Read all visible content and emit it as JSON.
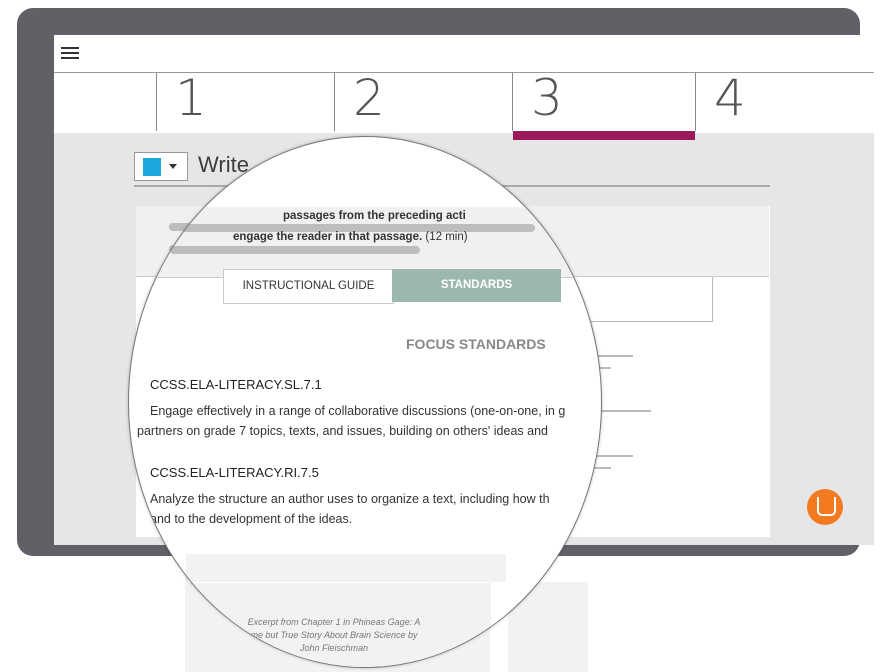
{
  "steps": [
    {
      "label": "1",
      "active": false
    },
    {
      "label": "2",
      "active": false
    },
    {
      "label": "3",
      "active": true
    },
    {
      "label": "4",
      "active": false
    }
  ],
  "colors": {
    "accent": "#9b1a5a",
    "swatch": "#1aa7e0",
    "tab_active": "#9bb7b0",
    "chat": "#f47a20"
  },
  "section": {
    "title": "Write"
  },
  "instructions": {
    "line1": "passages from the preceding acti",
    "line2_bold": "engage the reader in that passage.",
    "line2_time": "(12 min)"
  },
  "tabs": {
    "guide": "INSTRUCTIONAL GUIDE",
    "standards": "STANDARDS"
  },
  "focus_title": "FOCUS STANDARDS",
  "standards": [
    {
      "code": "CCSS.ELA-LITERACY.SL.7.1",
      "desc_lines": [
        "Engage effectively in a range of collaborative discussions (one-on-one, in g",
        "partners on grade 7 topics, texts, and issues, building on others' ideas and"
      ]
    },
    {
      "code": "CCSS.ELA-LITERACY.RI.7.5",
      "desc_lines": [
        "Analyze the structure an author uses to organize a text, including how th",
        "and to the development of the ideas."
      ]
    }
  ],
  "caption_lines": [
    "Excerpt from Chapter 1 in Phineas Gage: A",
    "me but True Story About Brain Science by",
    "John Fleischman"
  ]
}
